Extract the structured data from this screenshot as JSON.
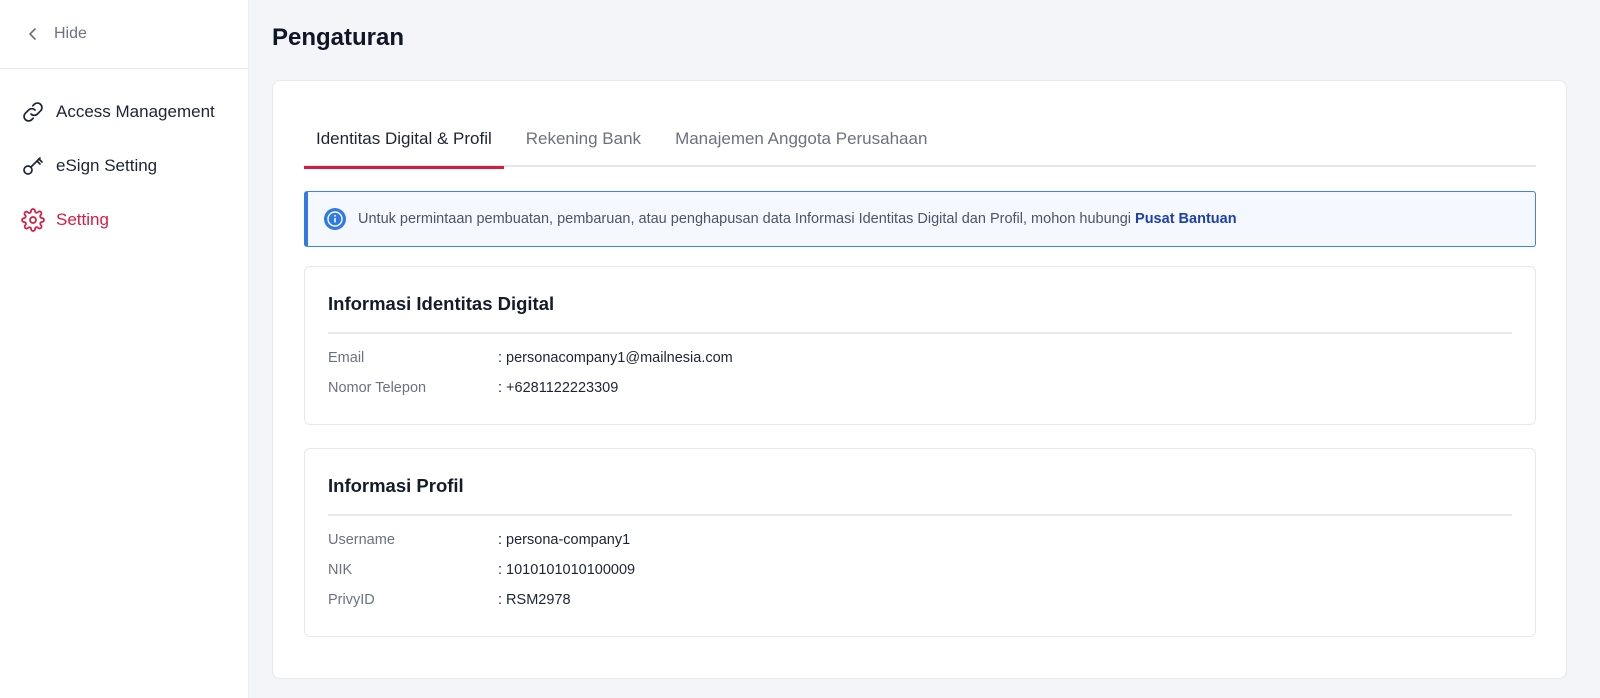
{
  "sidebar": {
    "hide_label": "Hide",
    "items": [
      {
        "label": "Access Management",
        "icon": "link-icon"
      },
      {
        "label": "eSign Setting",
        "icon": "key-icon"
      },
      {
        "label": "Setting",
        "icon": "gear-icon",
        "active": true
      }
    ]
  },
  "page": {
    "title": "Pengaturan"
  },
  "tabs": [
    {
      "label": "Identitas Digital & Profil",
      "active": true
    },
    {
      "label": "Rekening Bank"
    },
    {
      "label": "Manajemen Anggota Perusahaan"
    }
  ],
  "info": {
    "text": "Untuk permintaan pembuatan, pembaruan, atau penghapusan data Informasi Identitas Digital dan Profil, mohon hubungi",
    "link": "Pusat Bantuan"
  },
  "identity": {
    "title": "Informasi Identitas Digital",
    "rows": [
      {
        "label": "Email",
        "value": ": personacompany1@mailnesia.com"
      },
      {
        "label": "Nomor Telepon",
        "value": ": +6281122223309"
      }
    ]
  },
  "profile": {
    "title": "Informasi Profil",
    "rows": [
      {
        "label": "Username",
        "value": ": persona-company1"
      },
      {
        "label": "NIK",
        "value": ": 1010101010100009"
      },
      {
        "label": "PrivyID",
        "value": ": RSM2978"
      }
    ]
  },
  "colors": {
    "accent": "#d81b3f",
    "info_border": "#3b82f6",
    "link": "#1e40af"
  }
}
